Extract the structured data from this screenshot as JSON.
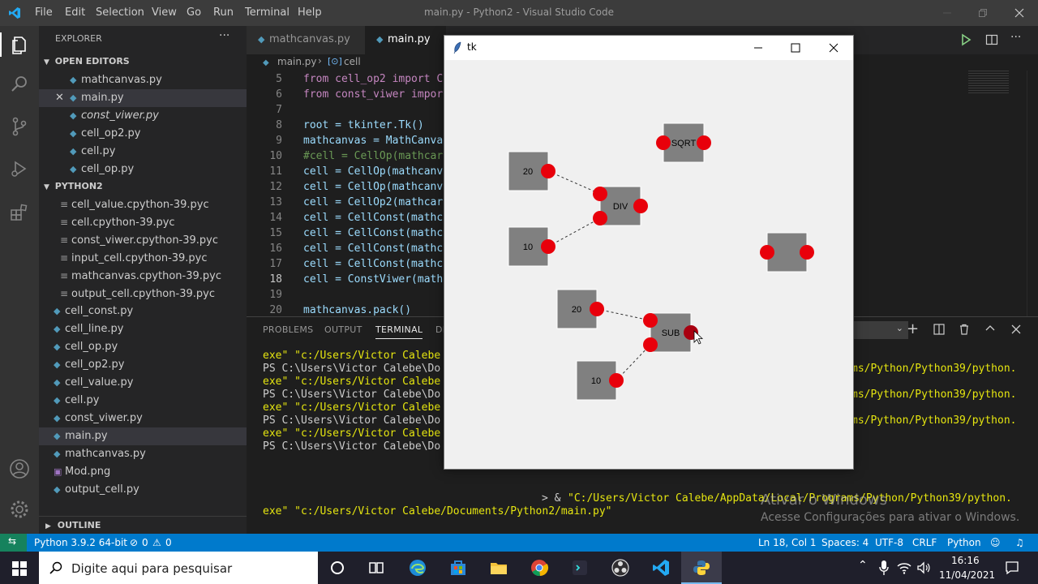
{
  "titlebar": {
    "menu": [
      "File",
      "Edit",
      "Selection",
      "View",
      "Go",
      "Run",
      "Terminal",
      "Help"
    ],
    "title": "main.py - Python2 - Visual Studio Code"
  },
  "sidebar": {
    "header": "EXPLORER",
    "more": "···",
    "open_editors_label": "OPEN EDITORS",
    "open_editors": [
      {
        "name": "mathcanvas.py"
      },
      {
        "name": "main.py"
      },
      {
        "name": "const_viwer.py"
      },
      {
        "name": "cell_op2.py"
      },
      {
        "name": "cell.py"
      },
      {
        "name": "cell_op.py"
      }
    ],
    "folder_label": "PYTHON2",
    "files": [
      {
        "name": "cell_value.cpython-39.pyc"
      },
      {
        "name": "cell.cpython-39.pyc"
      },
      {
        "name": "const_viwer.cpython-39.pyc"
      },
      {
        "name": "input_cell.cpython-39.pyc"
      },
      {
        "name": "mathcanvas.cpython-39.pyc"
      },
      {
        "name": "output_cell.cpython-39.pyc"
      },
      {
        "name": "cell_const.py"
      },
      {
        "name": "cell_line.py"
      },
      {
        "name": "cell_op.py"
      },
      {
        "name": "cell_op2.py"
      },
      {
        "name": "cell_value.py"
      },
      {
        "name": "cell.py"
      },
      {
        "name": "const_viwer.py"
      },
      {
        "name": "main.py"
      },
      {
        "name": "mathcanvas.py"
      },
      {
        "name": "Mod.png"
      },
      {
        "name": "output_cell.py"
      }
    ],
    "outline_label": "OUTLINE"
  },
  "tabs": [
    {
      "label": "mathcanvas.py"
    },
    {
      "label": "main.py"
    }
  ],
  "breadcrumb": {
    "file": "main.py",
    "symbol": "cell"
  },
  "editor": {
    "lines": [
      {
        "n": "5",
        "text": "from cell_op2 import C"
      },
      {
        "n": "6",
        "text": "from const_viwer impor"
      },
      {
        "n": "7",
        "text": ""
      },
      {
        "n": "8",
        "text": "root = tkinter.Tk()"
      },
      {
        "n": "9",
        "text": "mathcanvas = MathCanva"
      },
      {
        "n": "10",
        "text": "#cell = CellOp(mathcar"
      },
      {
        "n": "11",
        "text": "cell = CellOp(mathcanv"
      },
      {
        "n": "12",
        "text": "cell = CellOp(mathcanv"
      },
      {
        "n": "13",
        "text": "cell = CellOp2(mathcar"
      },
      {
        "n": "14",
        "text": "cell = CellConst(mathc"
      },
      {
        "n": "15",
        "text": "cell = CellConst(mathc"
      },
      {
        "n": "16",
        "text": "cell = CellConst(mathc"
      },
      {
        "n": "17",
        "text": "cell = CellConst(mathc"
      },
      {
        "n": "18",
        "text": "cell = ConstViwer(math"
      },
      {
        "n": "19",
        "text": ""
      },
      {
        "n": "20",
        "text": "mathcanvas.pack()"
      }
    ]
  },
  "panel": {
    "tabs": [
      "PROBLEMS",
      "OUTPUT",
      "TERMINAL",
      "DE"
    ],
    "terminal_left": [
      "exe\" \"c:/Users/Victor Calebe",
      "PS C:\\Users\\Victor Calebe\\Do",
      "exe\" \"c:/Users/Victor Calebe",
      "PS C:\\Users\\Victor Calebe\\Do",
      "exe\" \"c:/Users/Victor Calebe",
      "PS C:\\Users\\Victor Calebe\\Do",
      "exe\" \"c:/Users/Victor Calebe",
      "PS C:\\Users\\Victor Calebe\\Do"
    ],
    "terminal_right": [
      "ms/Python/Python39/python.",
      "ms/Python/Python39/python.",
      "ms/Python/Python39/python."
    ],
    "cmd_prefix": "> & ",
    "cmd_path": "\"C:/Users/Victor Calebe/AppData/Local/Programs/Python/Python39/python.",
    "last_line": "exe\" \"c:/Users/Victor Calebe/Documents/Python2/main.py\""
  },
  "watermark": {
    "line1": "Ativar o Windows",
    "line2": "Acesse Configurações para ativar o Windows."
  },
  "statusbar": {
    "interpreter": "Python 3.9.2 64-bit",
    "errors": "0",
    "warnings": "0",
    "position": "Ln 18, Col 1",
    "spaces": "Spaces: 4",
    "encoding": "UTF-8",
    "eol": "CRLF",
    "language": "Python"
  },
  "taskbar": {
    "search_placeholder": "Digite aqui para pesquisar",
    "time": "16:16",
    "date": "11/04/2021"
  },
  "tk": {
    "title": "tk",
    "cells": [
      {
        "label": "SQRT"
      },
      {
        "label": "20"
      },
      {
        "label": "DIV"
      },
      {
        "label": "10"
      },
      {
        "label": ""
      },
      {
        "label": "20"
      },
      {
        "label": "SUB"
      },
      {
        "label": "10"
      }
    ]
  },
  "colors": {
    "accent": "#007acc",
    "port": "#e8000b",
    "cell": "#808080"
  }
}
